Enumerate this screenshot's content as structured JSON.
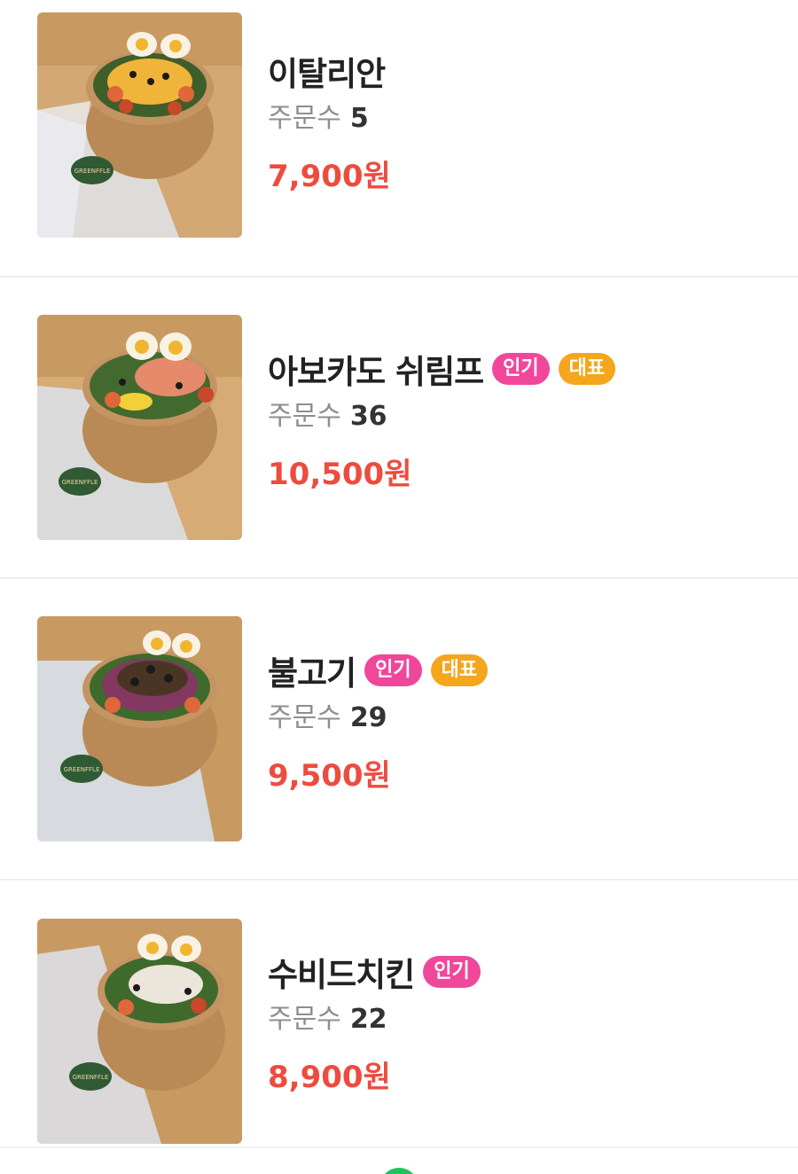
{
  "menu_items": [
    {
      "name": "이탈리안",
      "badges": [],
      "orders_label": "주문수",
      "orders_count": "5",
      "price": "7,900원",
      "topping": "cheese",
      "brand": "GREENFFLE"
    },
    {
      "name": "아보카도 쉬림프",
      "badges": [
        "인기",
        "대표"
      ],
      "orders_label": "주문수",
      "orders_count": "36",
      "price": "10,500원",
      "topping": "shrimp",
      "brand": "GREENFFLE"
    },
    {
      "name": "불고기",
      "badges": [
        "인기",
        "대표"
      ],
      "orders_label": "주문수",
      "orders_count": "29",
      "price": "9,500원",
      "topping": "bulgogi",
      "brand": "GREENFFLE"
    },
    {
      "name": "수비드치킨",
      "badges": [
        "인기"
      ],
      "orders_label": "주문수",
      "orders_count": "22",
      "price": "8,900원",
      "topping": "chicken",
      "brand": "GREENFFLE"
    }
  ],
  "colors": {
    "price": "#ee4b3f",
    "badge_popular": "#f0479b",
    "badge_signature": "#f4a61c",
    "fab": "#21c35b"
  }
}
